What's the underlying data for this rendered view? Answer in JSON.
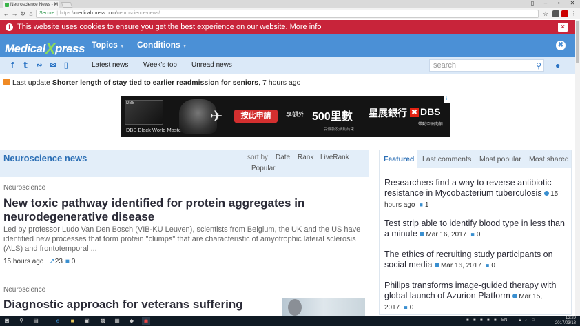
{
  "browser": {
    "tab_title": "Neuroscience News - M",
    "url_secure": "Secure",
    "url_scheme": "https://",
    "url_host": "medicalxpress.com",
    "url_path": "/neuroscience-news/"
  },
  "cookie_bar": {
    "message": "This website uses cookies to ensure you get the best experience on our website. More info",
    "close": "×"
  },
  "header": {
    "logo_left": "Medical",
    "logo_x": "X",
    "logo_right": "press",
    "menu": [
      "Topics",
      "Conditions"
    ]
  },
  "subnav": {
    "links": [
      "Latest news",
      "Week's top",
      "Unread news"
    ],
    "search_placeholder": "search"
  },
  "update": {
    "prefix": "Last update",
    "headline": "Shorter length of stay tied to earlier readmission for seniors",
    "suffix": ", 7 hours ago"
  },
  "ad": {
    "card_brand": "DBS",
    "card_label": "DBS Black World MasterCard®",
    "apply": "按此申請",
    "enjoy": "享額外",
    "miles": "500里數",
    "fine_print": "受條款及細則約束",
    "bank": "星展銀行",
    "dbs": "DBS",
    "tagline": "帶動亞洲向前"
  },
  "news": {
    "section_title": "Neuroscience news",
    "sort_by": "sort by:",
    "sort_options": [
      "Date",
      "Rank",
      "LiveRank",
      "Popular"
    ],
    "articles": [
      {
        "category": "Neuroscience",
        "title": "New toxic pathway identified for protein aggregates in neurodegenerative disease",
        "excerpt": "Led by professor Ludo Van Den Bosch (VIB-KU Leuven), scientists from Belgium, the UK and the US have identified new processes that form protein \"clumps\" that are characteristic of amyotrophic lateral sclerosis (ALS) and frontotemporal ...",
        "time": "15 hours ago",
        "shares": "23",
        "comments": "0"
      },
      {
        "category": "Neuroscience",
        "title": "Diagnostic approach for veterans suffering"
      }
    ]
  },
  "right_panel": {
    "tabs": [
      "Featured",
      "Last comments",
      "Most popular",
      "Most shared"
    ],
    "items": [
      {
        "title": "Researchers find a way to reverse antibiotic resistance in Mycobacterium tuberculosis",
        "rank": "15",
        "date": "hours ago",
        "comments": "1"
      },
      {
        "title": "Test strip able to identify blood type in less than a minute",
        "date": "Mar 16, 2017",
        "comments": "0"
      },
      {
        "title": "The ethics of recruiting study participants on social media",
        "date": "Mar 16, 2017",
        "comments": "0"
      },
      {
        "title": "Philips transforms image-guided therapy with global launch of Azurion Platform",
        "date": "Mar 15, 2017",
        "comments": "0"
      }
    ]
  },
  "taskbar": {
    "lang": "EN",
    "time": "12:29",
    "date": "2017/03/18"
  },
  "colors": {
    "cookie_red": "#c8243a",
    "header_blue": "#4b90d6",
    "subnav_blue": "#dbe9f8",
    "link_blue": "#2c6fb5"
  }
}
